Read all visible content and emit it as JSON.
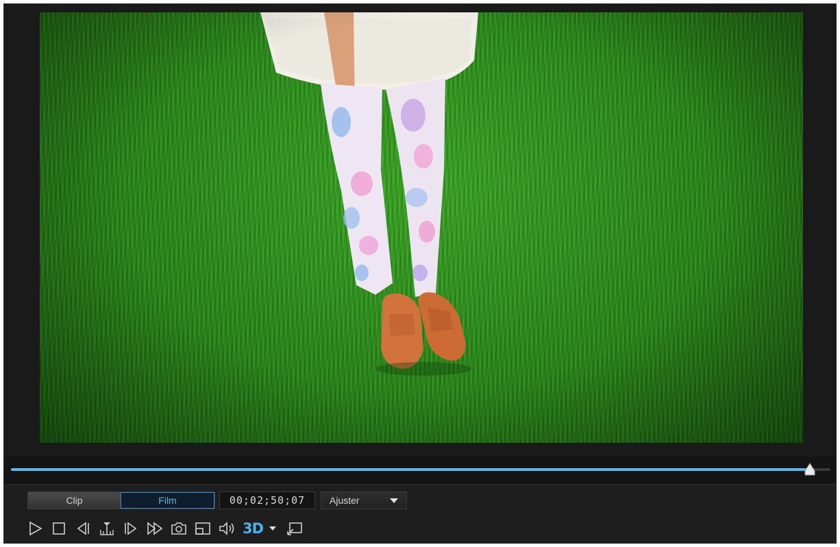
{
  "preview": {
    "frame_description_icon": "video-frame"
  },
  "timeline": {
    "progress_fraction": 0.975
  },
  "mode": {
    "clip_label": "Clip",
    "film_label": "Film",
    "active": "film"
  },
  "timecode": "00;02;50;07",
  "zoom": {
    "selected": "Ajuster"
  },
  "buttons": [
    {
      "name": "play-button",
      "icon": "play-icon"
    },
    {
      "name": "stop-button",
      "icon": "stop-icon"
    },
    {
      "name": "previous-frame-button",
      "icon": "previous-frame-icon"
    },
    {
      "name": "split-button",
      "icon": "split-icon"
    },
    {
      "name": "next-frame-button",
      "icon": "next-frame-icon"
    },
    {
      "name": "fast-forward-button",
      "icon": "fast-forward-icon"
    },
    {
      "name": "snapshot-button",
      "icon": "camera-icon"
    },
    {
      "name": "display-size-button",
      "icon": "display-size-icon"
    },
    {
      "name": "volume-button",
      "icon": "volume-icon"
    },
    {
      "name": "3d-mode-button",
      "icon": "3d-icon",
      "label": "3D"
    },
    {
      "name": "3d-options-dropdown",
      "icon": "chevron-down-icon"
    },
    {
      "name": "undock-preview-button",
      "icon": "undock-icon"
    }
  ],
  "colors": {
    "accent": "#5fb6e0",
    "background": "#1e1e1e",
    "threeD": "#4fb0ea"
  }
}
